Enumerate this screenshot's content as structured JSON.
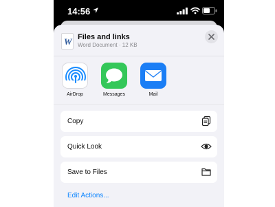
{
  "status_bar": {
    "time": "14:56"
  },
  "share_sheet": {
    "file": {
      "title": "Files and links",
      "subtitle": "Word Document · 12 KB",
      "thumb_letter": "W"
    },
    "apps": [
      {
        "label": "AirDrop",
        "icon": "airdrop-icon"
      },
      {
        "label": "Messages",
        "icon": "messages-icon"
      },
      {
        "label": "Mail",
        "icon": "mail-icon"
      }
    ],
    "actions": [
      {
        "label": "Copy",
        "icon": "copy-icon"
      },
      {
        "label": "Quick Look",
        "icon": "eye-icon"
      },
      {
        "label": "Save to Files",
        "icon": "folder-icon"
      }
    ],
    "edit_actions_label": "Edit Actions..."
  },
  "colors": {
    "accent": "#0a84ff",
    "sheet_background": "#f2f2f7",
    "messages_green": "#34c759",
    "mail_blue": "#1b7ef5",
    "word_blue": "#2b579a"
  }
}
